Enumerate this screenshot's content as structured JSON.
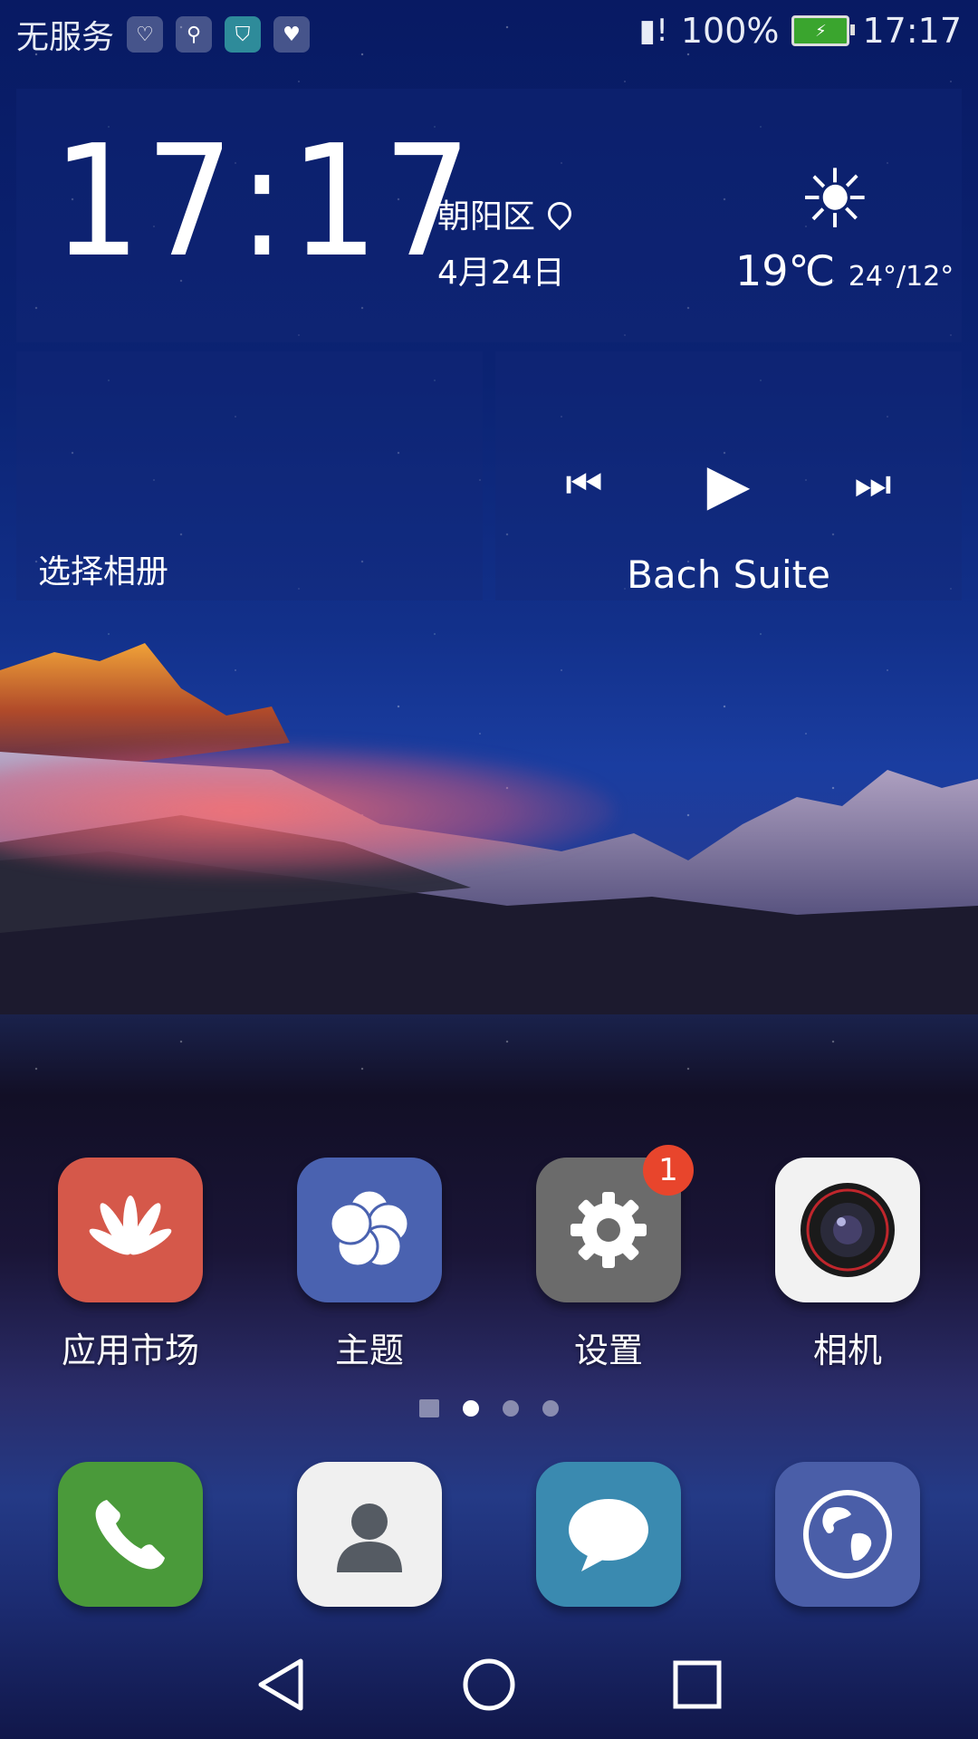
{
  "status_bar": {
    "carrier": "无服务",
    "battery_percent": "100%",
    "time": "17:17",
    "icons": [
      "pulse-icon",
      "usb-icon",
      "shield-icon",
      "heart-icon",
      "sim-alert-icon",
      "battery-charging-icon"
    ]
  },
  "clock_widget": {
    "time": "17:17",
    "district": "朝阳区",
    "date": "4月24日",
    "weather": {
      "icon": "sun-icon",
      "current_temp": "19℃",
      "range": "24°/12°"
    }
  },
  "album_widget": {
    "label": "选择相册"
  },
  "music_widget": {
    "track": "Bach Suite"
  },
  "apps": [
    {
      "label": "应用市场",
      "icon": "huawei-logo-icon",
      "color": "#d5584a"
    },
    {
      "label": "主题",
      "icon": "pinwheel-icon",
      "color": "#4a62b0"
    },
    {
      "label": "设置",
      "icon": "gear-icon",
      "color": "#6b6b6b",
      "badge": "1"
    },
    {
      "label": "相机",
      "icon": "camera-lens-icon",
      "color": "#f2f2f2"
    }
  ],
  "page_indicator": {
    "current": 1,
    "pages": 3
  },
  "dock": [
    {
      "icon": "phone-icon",
      "color": "#4a9a3a"
    },
    {
      "icon": "contact-icon",
      "color": "#f0f0f0"
    },
    {
      "icon": "message-icon",
      "color": "#3a8ab0"
    },
    {
      "icon": "globe-icon",
      "color": "#4a5ea8"
    }
  ]
}
